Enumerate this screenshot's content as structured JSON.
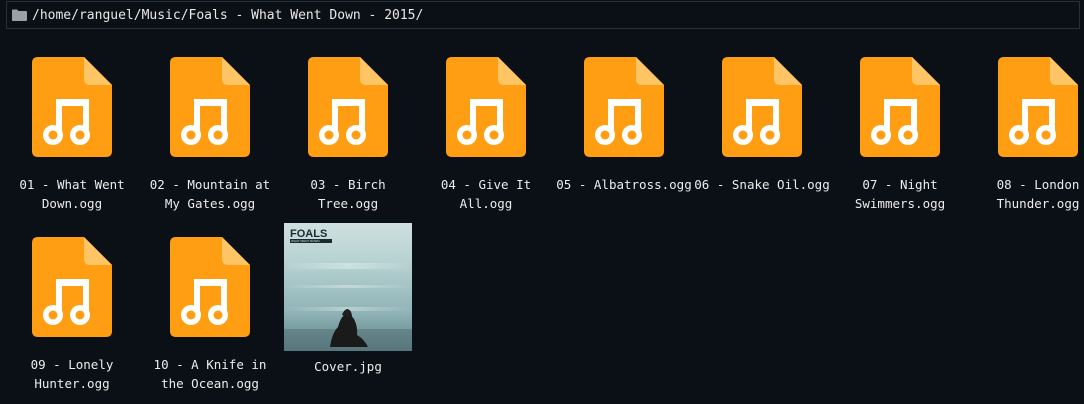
{
  "path_bar": {
    "path": "/home/ranguel/Music/Foals - What Went Down - 2015/",
    "icon": "folder-icon"
  },
  "files": [
    {
      "name": "01 - What Went\nDown.ogg",
      "icon": "music-file-icon"
    },
    {
      "name": "02 - Mountain at\nMy Gates.ogg",
      "icon": "music-file-icon"
    },
    {
      "name": "03 - Birch\nTree.ogg",
      "icon": "music-file-icon"
    },
    {
      "name": "04 - Give It\nAll.ogg",
      "icon": "music-file-icon"
    },
    {
      "name": "05 - Albatross.ogg",
      "icon": "music-file-icon"
    },
    {
      "name": "06 - Snake Oil.ogg",
      "icon": "music-file-icon"
    },
    {
      "name": "07 - Night\nSwimmers.ogg",
      "icon": "music-file-icon"
    },
    {
      "name": "08 - London\nThunder.ogg",
      "icon": "music-file-icon"
    },
    {
      "name": "09 - Lonely\nHunter.ogg",
      "icon": "music-file-icon"
    },
    {
      "name": "10 - A Knife in\nthe Ocean.ogg",
      "icon": "music-file-icon"
    }
  ],
  "cover": {
    "name": "Cover.jpg",
    "art_band": "FOALS",
    "art_album": "WHAT WENT DOWN"
  },
  "colors": {
    "background": "#0b1016",
    "icon_orange": "#ff9e12",
    "icon_fold": "#ffc463"
  }
}
